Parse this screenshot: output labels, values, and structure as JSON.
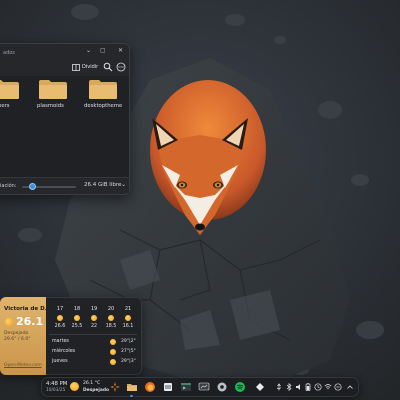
{
  "desktop": {
    "wallpaper_icon": "fox-on-rock-wallpaper"
  },
  "file_manager": {
    "title": "ados",
    "toolbar": {
      "split_label": "Dividir"
    },
    "folders": [
      {
        "label": "pers",
        "icon": "folder-icon"
      },
      {
        "label": "plasmoids",
        "icon": "folder-icon"
      },
      {
        "label": "desktoptheme",
        "icon": "folder-icon"
      }
    ],
    "status": {
      "zoom_label": "iación:",
      "zoom_level": 0.2,
      "free_space": "26.4 GiB libre"
    }
  },
  "weather_widget": {
    "location": "Victoria de D...",
    "current_temp": "26.1",
    "condition": "Despejado",
    "range": "29.6° / 6.0°",
    "link": "Open-Meteo.com",
    "hourly": [
      {
        "hour": "17",
        "temp": "26.6"
      },
      {
        "hour": "18",
        "temp": "25.5"
      },
      {
        "hour": "19",
        "temp": "22"
      },
      {
        "hour": "20",
        "temp": "18.5"
      },
      {
        "hour": "21",
        "temp": "16.1"
      }
    ],
    "daily": [
      {
        "day": "martes",
        "temps": "29°|2°"
      },
      {
        "day": "miércoles",
        "temps": "27°|5°"
      },
      {
        "day": "jueves",
        "temps": "29°|3°"
      }
    ],
    "accent_color": "#d9a85c"
  },
  "taskbar": {
    "clock_time": "4:48 PM",
    "clock_date": "10/03/25",
    "weather_temp": "26.1 °C",
    "weather_cond": "Despejado",
    "apps": [
      "app-menu-icon",
      "files-icon",
      "firefox-icon",
      "screenshot-icon",
      "terminal-icon",
      "monitor-icon",
      "settings-icon",
      "spotify-icon",
      "vault-icon"
    ],
    "tray": [
      "usb-icon",
      "bluetooth-icon",
      "volume-icon",
      "battery-icon",
      "clock-icon",
      "wifi-icon",
      "notifications-icon",
      "show-desktop-icon"
    ],
    "accent_color": "#3d8edc"
  }
}
